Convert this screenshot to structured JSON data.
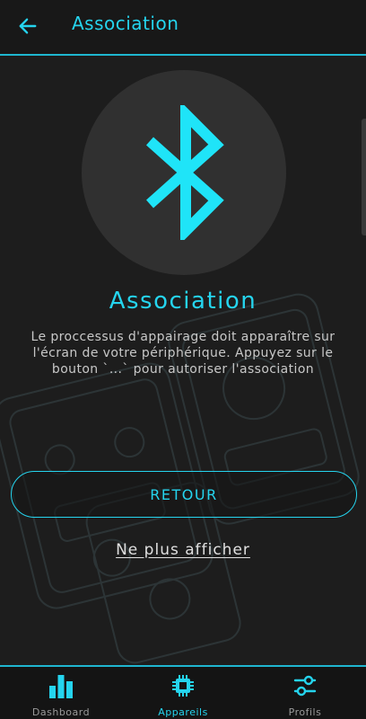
{
  "app": {
    "title": "Association",
    "accent": "#25d4ee"
  },
  "header": {
    "back_icon": "arrow-left-icon",
    "title": "Association"
  },
  "main": {
    "bluetooth_icon": "bluetooth-icon",
    "heading": "Association",
    "description": "Le proccessus d'appairage doit apparaître sur l'écran de votre périphérique. Appuyez sur le bouton `...` pour autoriser l'association",
    "retour_label": "RETOUR",
    "no_show_label": "Ne plus afficher"
  },
  "bottom_nav": {
    "items": [
      {
        "label": "Dashboard",
        "icon": "bar-chart-icon",
        "active": false
      },
      {
        "label": "Appareils",
        "icon": "chip-icon",
        "active": true
      },
      {
        "label": "Profils",
        "icon": "sliders-icon",
        "active": false
      }
    ]
  }
}
